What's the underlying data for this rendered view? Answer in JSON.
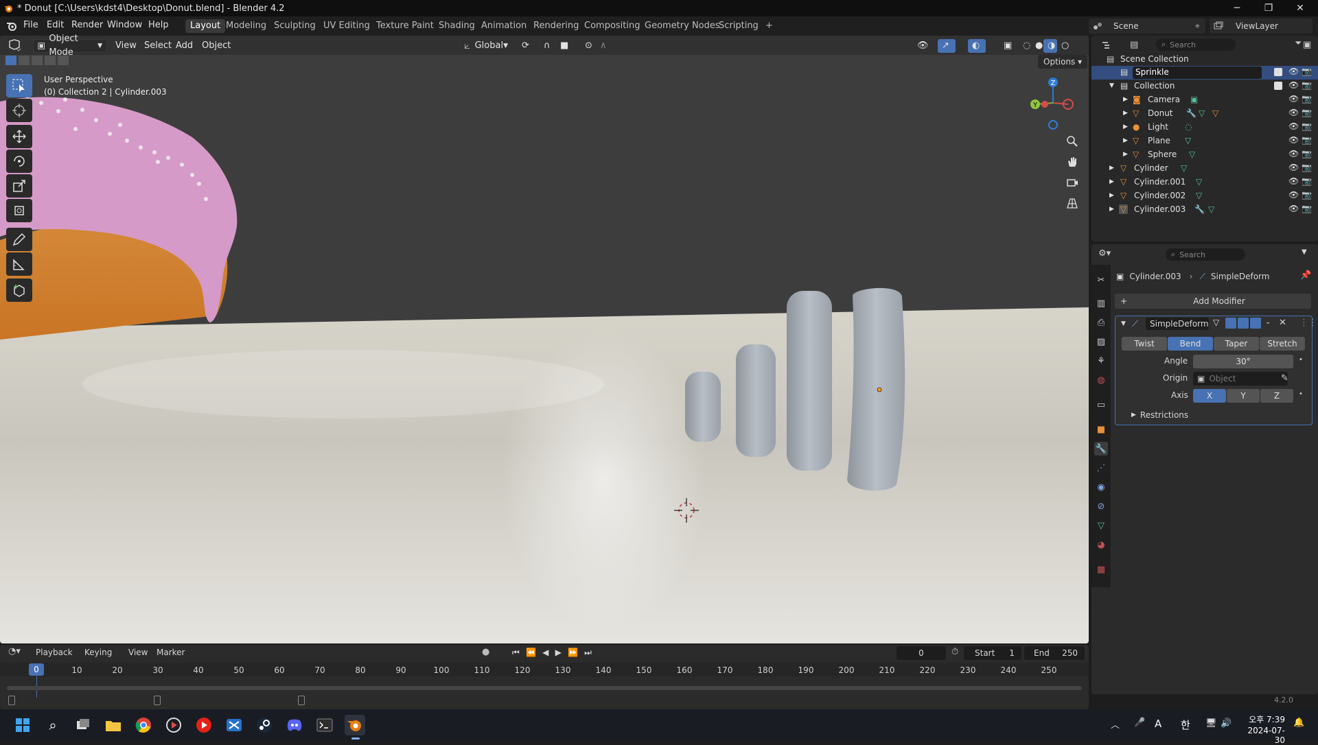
{
  "window": {
    "title": "* Donut [C:\\Users\\kdst4\\Desktop\\Donut.blend] - Blender 4.2"
  },
  "menu": {
    "items": [
      "File",
      "Edit",
      "Render",
      "Window",
      "Help"
    ]
  },
  "workspaces": {
    "tabs": [
      "Layout",
      "Modeling",
      "Sculpting",
      "UV Editing",
      "Texture Paint",
      "Shading",
      "Animation",
      "Rendering",
      "Compositing",
      "Geometry Nodes",
      "Scripting"
    ],
    "active": "Layout",
    "add": "+"
  },
  "scene": {
    "label": "Scene",
    "viewlayer": "ViewLayer"
  },
  "viewport": {
    "mode": "Object Mode",
    "menus": [
      "View",
      "Select",
      "Add",
      "Object"
    ],
    "orientation": "Global",
    "options": "Options",
    "overlay_line1": "User Perspective",
    "overlay_line2": "(0) Collection 2 | Cylinder.003",
    "gizmo": {
      "x": "X",
      "y": "Y",
      "z": "Z"
    }
  },
  "outliner": {
    "search_placeholder": "Search",
    "root": "Scene Collection",
    "editing_name": "Sprinkle",
    "collection": "Collection",
    "children": [
      "Camera",
      "Donut",
      "Light",
      "Plane",
      "Sphere"
    ],
    "top_objects": [
      "Cylinder",
      "Cylinder.001",
      "Cylinder.002",
      "Cylinder.003"
    ]
  },
  "properties": {
    "search_placeholder": "Search",
    "breadcrumb_object": "Cylinder.003",
    "breadcrumb_modifier": "SimpleDeform",
    "add_modifier": "Add Modifier",
    "modifier_name": "SimpleDeform",
    "modes": [
      "Twist",
      "Bend",
      "Taper",
      "Stretch"
    ],
    "active_mode": "Bend",
    "angle_label": "Angle",
    "angle_value": "30°",
    "origin_label": "Origin",
    "origin_placeholder": "Object",
    "axis_label": "Axis",
    "axes": [
      "X",
      "Y",
      "Z"
    ],
    "active_axis": "X",
    "restrictions": "Restrictions"
  },
  "timeline": {
    "menus": [
      "Playback",
      "Keying",
      "View",
      "Marker"
    ],
    "current_frame": "0",
    "start_label": "Start",
    "start": "1",
    "end_label": "End",
    "end": "250",
    "ticks": [
      "0",
      "10",
      "20",
      "30",
      "40",
      "50",
      "60",
      "70",
      "80",
      "90",
      "100",
      "110",
      "120",
      "130",
      "140",
      "150",
      "160",
      "170",
      "180",
      "190",
      "200",
      "210",
      "220",
      "230",
      "240",
      "250"
    ]
  },
  "status": {
    "version": "4.2.0"
  },
  "taskbar": {
    "time": "오후 7:39",
    "date": "2024-07-30",
    "ime1": "A",
    "ime2": "한"
  },
  "colors": {
    "accent": "#4772b3",
    "viewport_bg": "#3d3d3d",
    "panel_bg": "#2b2b2b",
    "playhead": "#4772b3",
    "icon_orange": "#e8903a",
    "icon_green": "#56c19b"
  }
}
